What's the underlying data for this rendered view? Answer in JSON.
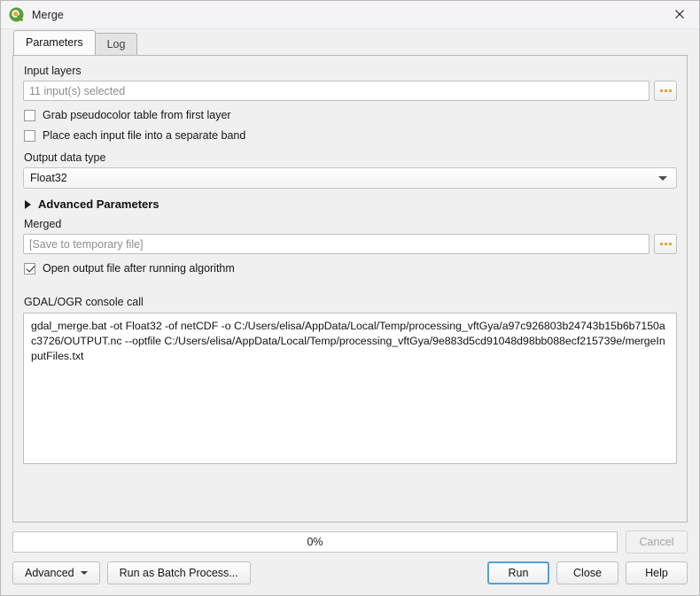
{
  "window": {
    "title": "Merge",
    "logo_icon": "qgis-logo-icon",
    "close_icon": "close-icon"
  },
  "tabs": [
    {
      "label": "Parameters",
      "active": true
    },
    {
      "label": "Log",
      "active": false
    }
  ],
  "parameters": {
    "input_layers": {
      "label": "Input layers",
      "value": "11 input(s) selected",
      "browse_label": "...",
      "browse_icon": "ellipsis-icon"
    },
    "grab_pseudocolor": {
      "label": "Grab pseudocolor table from first layer",
      "checked": false
    },
    "separate_band": {
      "label": "Place each input file into a separate band",
      "checked": false
    },
    "output_data_type": {
      "label": "Output data type",
      "value": "Float32",
      "caret_icon": "chevron-down-icon"
    },
    "advanced_parameters": {
      "label": "Advanced Parameters",
      "expanded": false,
      "toggle_icon": "triangle-right-icon"
    },
    "merged": {
      "label": "Merged",
      "placeholder": "[Save to temporary file]",
      "value": "[Save to temporary file]",
      "browse_icon": "ellipsis-icon"
    },
    "open_output": {
      "label": "Open output file after running algorithm",
      "checked": true
    },
    "console_call": {
      "label": "GDAL/OGR console call",
      "value": "gdal_merge.bat -ot Float32 -of netCDF -o C:/Users/elisa/AppData/Local/Temp/processing_vftGya/a97c926803b24743b15b6b7150ac3726/OUTPUT.nc --optfile C:/Users/elisa/AppData/Local/Temp/processing_vftGya/9e883d5cd91048d98bb088ecf215739e/mergeInputFiles.txt"
    }
  },
  "footer": {
    "progress_text": "0%",
    "progress_percent": 0,
    "cancel_label": "Cancel",
    "cancel_enabled": false,
    "advanced_label": "Advanced",
    "batch_label": "Run as Batch Process...",
    "run_label": "Run",
    "close_label": "Close",
    "help_label": "Help"
  },
  "colors": {
    "accent_focus": "#4ba3e3",
    "browse_dot": "#e8a33d",
    "window_bg": "#f0f0f0",
    "field_bg": "#ffffff"
  }
}
